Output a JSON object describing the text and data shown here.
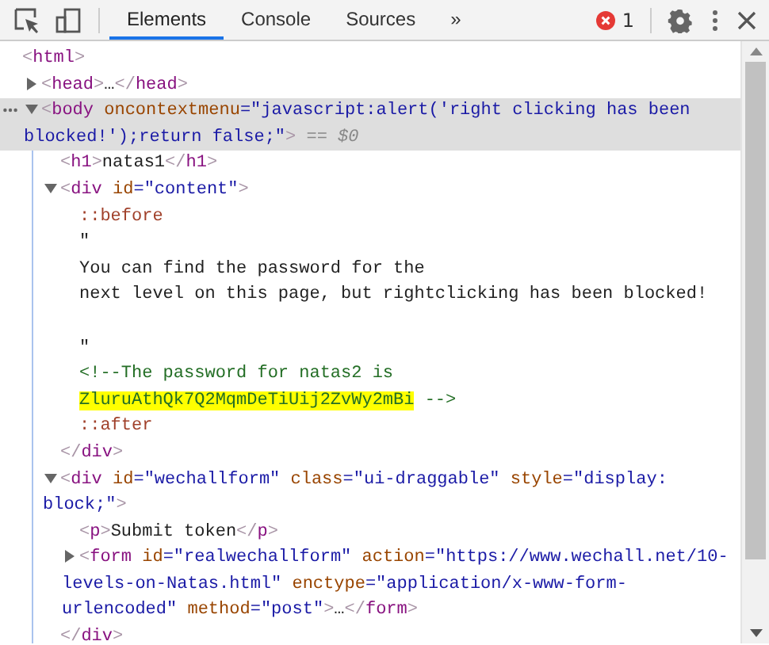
{
  "toolbar": {
    "tabs": [
      {
        "label": "Elements",
        "selected": true
      },
      {
        "label": "Console",
        "selected": false
      },
      {
        "label": "Sources",
        "selected": false
      }
    ],
    "overflow": "»",
    "error_count": "1"
  },
  "tree": [
    {
      "selected": false,
      "lines": [
        {
          "segments": [
            {
              "kind": "br",
              "text": "<"
            },
            {
              "kind": "tag",
              "text": "html"
            },
            {
              "kind": "br",
              "text": ">"
            }
          ]
        }
      ],
      "children": [
        {
          "selected": false,
          "expanded": false,
          "lines": [
            {
              "segments": [
                {
                  "kind": "br",
                  "text": "<"
                },
                {
                  "kind": "tag",
                  "text": "head"
                },
                {
                  "kind": "br",
                  "text": ">"
                },
                {
                  "kind": "text",
                  "text": "…"
                },
                {
                  "kind": "br",
                  "text": "</"
                },
                {
                  "kind": "tag",
                  "text": "head"
                },
                {
                  "kind": "br",
                  "text": ">"
                }
              ]
            }
          ]
        },
        {
          "selected": true,
          "expanded": true,
          "lines": [
            {
              "segments": [
                {
                  "kind": "br",
                  "text": "<"
                },
                {
                  "kind": "tag",
                  "text": "body"
                },
                {
                  "kind": "attr",
                  "text": " oncontextmenu"
                },
                {
                  "kind": "val",
                  "text": "=\"javascript:alert('right clicking has been"
                }
              ]
            },
            {
              "segments": [
                {
                  "kind": "val",
                  "text": "blocked!');return false;\""
                },
                {
                  "kind": "br",
                  "text": ">"
                },
                {
                  "kind": "eq",
                  "text": " == $0"
                }
              ]
            }
          ],
          "children": [
            {
              "selected": false,
              "lines": [
                {
                  "segments": [
                    {
                      "kind": "br",
                      "text": "<"
                    },
                    {
                      "kind": "tag",
                      "text": "h1"
                    },
                    {
                      "kind": "br",
                      "text": ">"
                    },
                    {
                      "kind": "text",
                      "text": "natas1"
                    },
                    {
                      "kind": "br",
                      "text": "</"
                    },
                    {
                      "kind": "tag",
                      "text": "h1"
                    },
                    {
                      "kind": "br",
                      "text": ">"
                    }
                  ]
                }
              ]
            },
            {
              "selected": false,
              "expanded": true,
              "lines": [
                {
                  "segments": [
                    {
                      "kind": "br",
                      "text": "<"
                    },
                    {
                      "kind": "tag",
                      "text": "div"
                    },
                    {
                      "kind": "attr",
                      "text": " id"
                    },
                    {
                      "kind": "val",
                      "text": "=\"content\""
                    },
                    {
                      "kind": "br",
                      "text": ">"
                    }
                  ]
                }
              ],
              "children": [
                {
                  "selected": false,
                  "lines": [
                    {
                      "segments": [
                        {
                          "kind": "pseudo",
                          "text": "::before"
                        }
                      ]
                    }
                  ]
                },
                {
                  "selected": false,
                  "lines": [
                    {
                      "segments": [
                        {
                          "kind": "text",
                          "text": "\""
                        }
                      ]
                    },
                    {
                      "segments": [
                        {
                          "kind": "text",
                          "text": "You can find the password for the"
                        }
                      ]
                    },
                    {
                      "segments": [
                        {
                          "kind": "text",
                          "text": "next level on this page, but rightclicking has been blocked!"
                        }
                      ]
                    },
                    {
                      "kind": "blank"
                    },
                    {
                      "segments": [
                        {
                          "kind": "text",
                          "text": "\""
                        }
                      ]
                    }
                  ]
                },
                {
                  "selected": false,
                  "lines": [
                    {
                      "segments": [
                        {
                          "kind": "comment",
                          "text": "<!--The password for natas2 is"
                        }
                      ]
                    },
                    {
                      "segments": [
                        {
                          "kind": "comment",
                          "text": "ZluruAthQk7Q2MqmDeTiUij2ZvWy2mBi",
                          "highlight": true
                        },
                        {
                          "kind": "comment",
                          "text": " -->"
                        }
                      ]
                    }
                  ]
                },
                {
                  "selected": false,
                  "lines": [
                    {
                      "segments": [
                        {
                          "kind": "pseudo",
                          "text": "::after"
                        }
                      ]
                    }
                  ]
                }
              ],
              "close": [
                {
                  "kind": "br",
                  "text": "</"
                },
                {
                  "kind": "tag",
                  "text": "div"
                },
                {
                  "kind": "br",
                  "text": ">"
                }
              ]
            },
            {
              "selected": false,
              "expanded": true,
              "lines": [
                {
                  "segments": [
                    {
                      "kind": "br",
                      "text": "<"
                    },
                    {
                      "kind": "tag",
                      "text": "div"
                    },
                    {
                      "kind": "attr",
                      "text": " id"
                    },
                    {
                      "kind": "val",
                      "text": "=\"wechallform\""
                    },
                    {
                      "kind": "attr",
                      "text": " class"
                    },
                    {
                      "kind": "val",
                      "text": "=\"ui-draggable\""
                    },
                    {
                      "kind": "attr",
                      "text": " style"
                    },
                    {
                      "kind": "val",
                      "text": "=\"display:"
                    }
                  ]
                },
                {
                  "segments": [
                    {
                      "kind": "val",
                      "text": "block;\""
                    },
                    {
                      "kind": "br",
                      "text": ">"
                    }
                  ]
                }
              ],
              "children": [
                {
                  "selected": false,
                  "lines": [
                    {
                      "segments": [
                        {
                          "kind": "br",
                          "text": "<"
                        },
                        {
                          "kind": "tag",
                          "text": "p"
                        },
                        {
                          "kind": "br",
                          "text": ">"
                        },
                        {
                          "kind": "text",
                          "text": "Submit token"
                        },
                        {
                          "kind": "br",
                          "text": "</"
                        },
                        {
                          "kind": "tag",
                          "text": "p"
                        },
                        {
                          "kind": "br",
                          "text": ">"
                        }
                      ]
                    }
                  ]
                },
                {
                  "selected": false,
                  "expanded": false,
                  "lines": [
                    {
                      "segments": [
                        {
                          "kind": "br",
                          "text": "<"
                        },
                        {
                          "kind": "tag",
                          "text": "form"
                        },
                        {
                          "kind": "attr",
                          "text": " id"
                        },
                        {
                          "kind": "val",
                          "text": "=\"realwechallform\""
                        },
                        {
                          "kind": "attr",
                          "text": " action"
                        },
                        {
                          "kind": "val",
                          "text": "=\"https://www.wechall.net/10-"
                        }
                      ]
                    },
                    {
                      "segments": [
                        {
                          "kind": "val",
                          "text": "levels-on-Natas.html\""
                        },
                        {
                          "kind": "attr",
                          "text": " enctype"
                        },
                        {
                          "kind": "val",
                          "text": "=\"application/x-www-form-"
                        }
                      ]
                    },
                    {
                      "segments": [
                        {
                          "kind": "val",
                          "text": "urlencoded\""
                        },
                        {
                          "kind": "attr",
                          "text": " method"
                        },
                        {
                          "kind": "val",
                          "text": "=\"post\""
                        },
                        {
                          "kind": "br",
                          "text": ">"
                        },
                        {
                          "kind": "text",
                          "text": "…"
                        },
                        {
                          "kind": "br",
                          "text": "</"
                        },
                        {
                          "kind": "tag",
                          "text": "form"
                        },
                        {
                          "kind": "br",
                          "text": ">"
                        }
                      ]
                    }
                  ]
                }
              ],
              "close": [
                {
                  "kind": "br",
                  "text": "</"
                },
                {
                  "kind": "tag",
                  "text": "div"
                },
                {
                  "kind": "br",
                  "text": ">"
                }
              ]
            }
          ]
        }
      ]
    }
  ]
}
